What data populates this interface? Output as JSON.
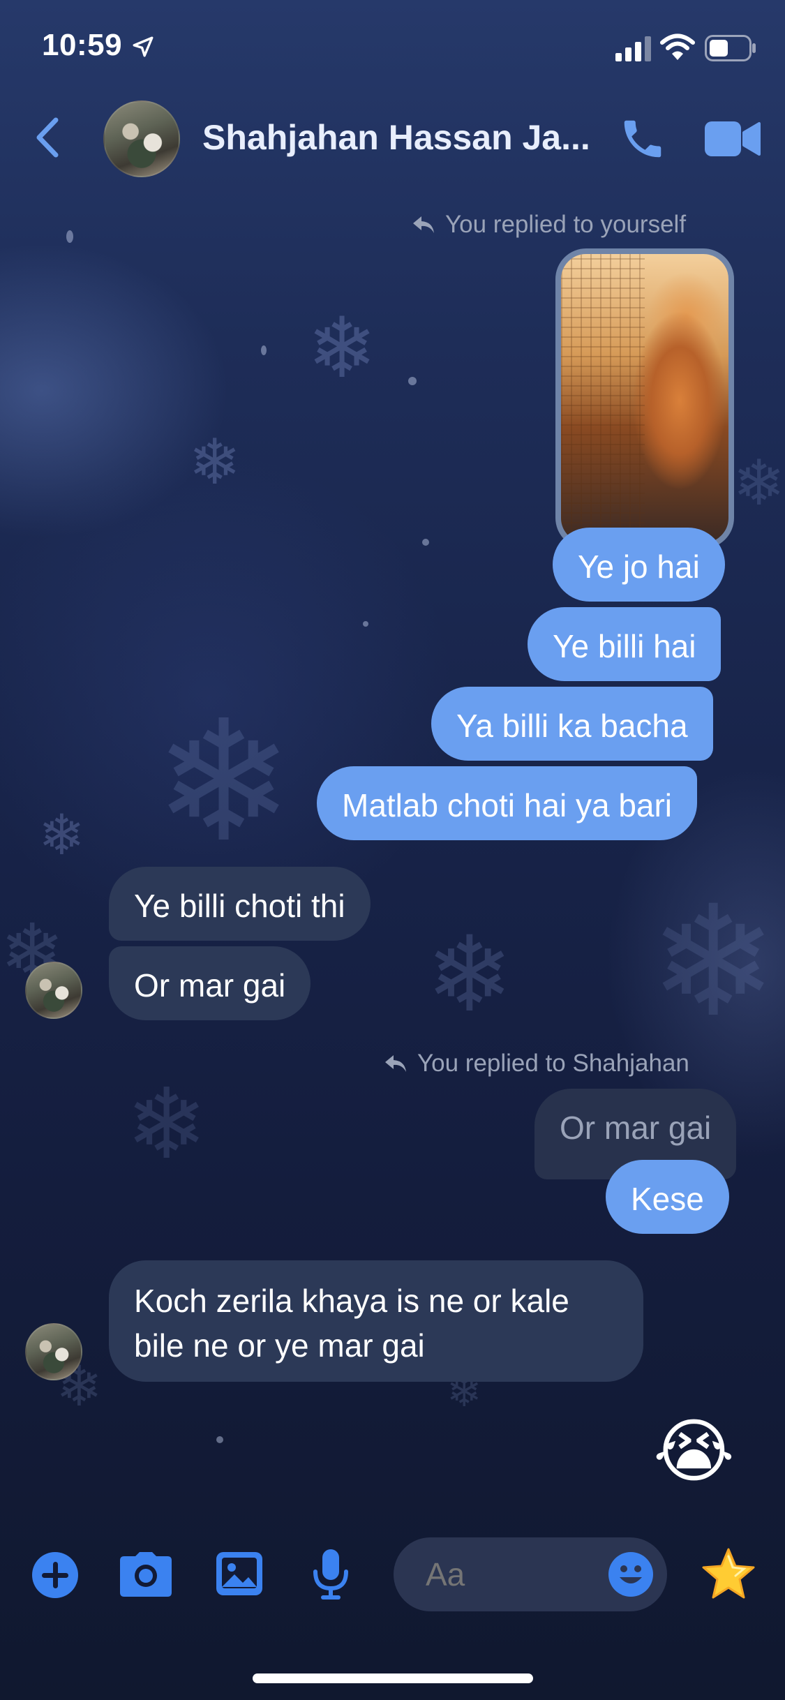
{
  "status_bar": {
    "time": "10:59"
  },
  "header": {
    "contact_name": "Shahjahan Hassan Ja..."
  },
  "messages": {
    "reply_note_1": "You replied to yourself",
    "sent_1": "Ye jo hai",
    "sent_2": "Ye billi hai",
    "sent_3": "Ya billi ka bacha",
    "sent_4": "Matlab choti hai ya bari",
    "recv_1": "Ye billi choti thi",
    "recv_2": "Or mar gai",
    "reply_note_2": "You replied to Shahjahan",
    "quoted": "Or mar gai",
    "sent_5": "Kese",
    "recv_3_line1": "Koch zerila khaya is ne or kale",
    "recv_3_line2": "bile  ne or ye mar gai",
    "emoji": "😭"
  },
  "composer": {
    "placeholder": "Aa"
  },
  "colors": {
    "accent": "#3b82f0",
    "sent_bubble": "#6a9ff0",
    "received_bubble": "#2c3957"
  }
}
